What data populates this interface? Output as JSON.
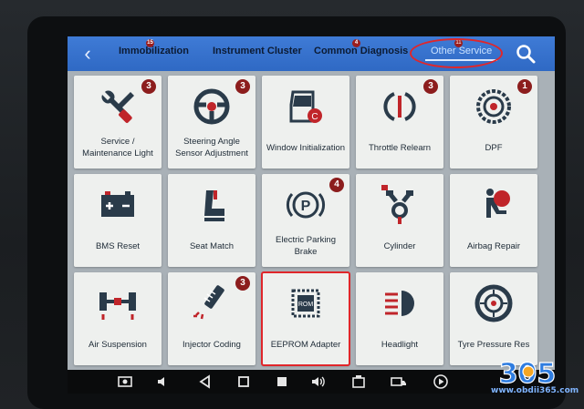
{
  "header": {
    "back_icon": "chevron-left-icon",
    "tabs": [
      {
        "label": "Immobilization",
        "count": "15"
      },
      {
        "label": "Instrument Cluster",
        "count": ""
      },
      {
        "label": "Common Diagnosis",
        "count": "4"
      },
      {
        "label": "Other Service",
        "count": "11",
        "active": true
      }
    ],
    "search_icon": "search-icon"
  },
  "tiles": [
    {
      "label": "Service / Maintenance Light",
      "badge": "3",
      "icon": "wrench-screwdriver-icon"
    },
    {
      "label": "Steering Angle Sensor Adjustment",
      "badge": "3",
      "icon": "steering-wheel-icon"
    },
    {
      "label": "Window Initialization",
      "badge": "",
      "icon": "car-door-icon"
    },
    {
      "label": "Throttle Relearn",
      "badge": "3",
      "icon": "throttle-icon"
    },
    {
      "label": "DPF",
      "badge": "1",
      "icon": "dpf-filter-icon"
    },
    {
      "label": "BMS Reset",
      "badge": "",
      "icon": "battery-icon"
    },
    {
      "label": "Seat Match",
      "badge": "",
      "icon": "seat-icon"
    },
    {
      "label": "Electric Parking Brake",
      "badge": "4",
      "icon": "parking-brake-icon"
    },
    {
      "label": "Cylinder",
      "badge": "",
      "icon": "cylinder-icon"
    },
    {
      "label": "Airbag Repair",
      "badge": "",
      "icon": "airbag-icon"
    },
    {
      "label": "Air Suspension",
      "badge": "",
      "icon": "suspension-icon"
    },
    {
      "label": "Injector Coding",
      "badge": "3",
      "icon": "injector-icon"
    },
    {
      "label": "EEPROM Adapter",
      "badge": "",
      "icon": "rom-chip-icon",
      "selected": true
    },
    {
      "label": "Headlight",
      "badge": "",
      "icon": "headlight-icon"
    },
    {
      "label": "Tyre Pressure Res",
      "badge": "",
      "icon": "tyre-icon"
    }
  ],
  "navbar": [
    "screenshot-icon",
    "volume-down-icon",
    "back-triangle-icon",
    "home-square-icon",
    "recents-icon",
    "volume-up-icon",
    "vci-icon",
    "truck-icon",
    "play-icon"
  ],
  "watermark": {
    "logo": "305",
    "url": "www.obdii365.com"
  },
  "colors": {
    "topbar": "#3f7bd6",
    "badge": "#8c1d1d",
    "highlight": "#e0262a",
    "icon_dark": "#2a3b4a",
    "icon_accent": "#c0252a"
  }
}
